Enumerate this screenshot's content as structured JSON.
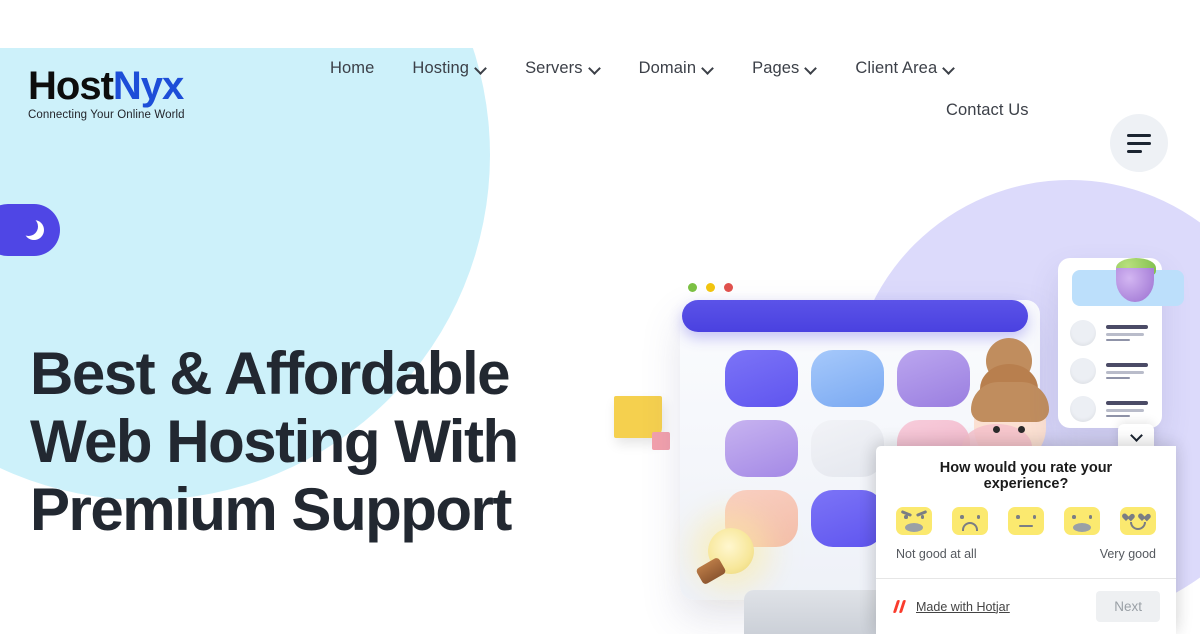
{
  "brand": {
    "logo_primary": "Host",
    "logo_secondary": "Nyx",
    "tagline": "Connecting Your Online World",
    "logo_primary_color": "#0d0d0d",
    "logo_secondary_color": "#1d4ed8"
  },
  "nav": {
    "primary": [
      {
        "label": "Home",
        "has_dropdown": false
      },
      {
        "label": "Hosting",
        "has_dropdown": true
      },
      {
        "label": "Servers",
        "has_dropdown": true
      },
      {
        "label": "Domain",
        "has_dropdown": true
      },
      {
        "label": "Pages",
        "has_dropdown": true
      },
      {
        "label": "Client Area",
        "has_dropdown": true
      }
    ],
    "secondary": [
      {
        "label": "Contact Us",
        "has_dropdown": false
      }
    ],
    "menu_icon": "hamburger-icon"
  },
  "theme_toggle": {
    "icon": "moon-icon",
    "accent_color": "#4f46e5"
  },
  "hero": {
    "heading": "Best & Affordable Web Hosting With Premium Support",
    "heading_color": "#222831"
  },
  "illustration": {
    "browser_dots": [
      "#7bc043",
      "#f1c40f",
      "#e0514d"
    ],
    "browser_bar_color": "#4a41e0",
    "tile_colors": [
      "#6f66f5",
      "#8fb6f5",
      "#a98ce8",
      "#b39be8",
      "#e9ebf1",
      "#f2bfcf",
      "#f6c3b4",
      "#6f66f5",
      "#ffffff"
    ],
    "sticky_note_color": "#f5d04e",
    "pink_square_color": "#f2a0ac",
    "bulb": "lightbulb-icon",
    "plant": "succulent-plant-icon",
    "card_banner_color": "#bcdffb",
    "card_rows": 3,
    "blob_cyan": "#cdf1fa",
    "blob_lavender": "#dcdafb"
  },
  "survey": {
    "question": "How would you rate your experience?",
    "faces": [
      {
        "name": "angry-face",
        "value": 1
      },
      {
        "name": "sad-face",
        "value": 2
      },
      {
        "name": "neutral-face",
        "value": 3
      },
      {
        "name": "happy-face",
        "value": 4
      },
      {
        "name": "heart-eyes-face",
        "value": 5
      }
    ],
    "scale_low": "Not good at all",
    "scale_high": "Very good",
    "branding": "Made with Hotjar",
    "next_label": "Next",
    "collapse_icon": "chevron-down-icon",
    "brand_color": "#fa3c2d"
  }
}
